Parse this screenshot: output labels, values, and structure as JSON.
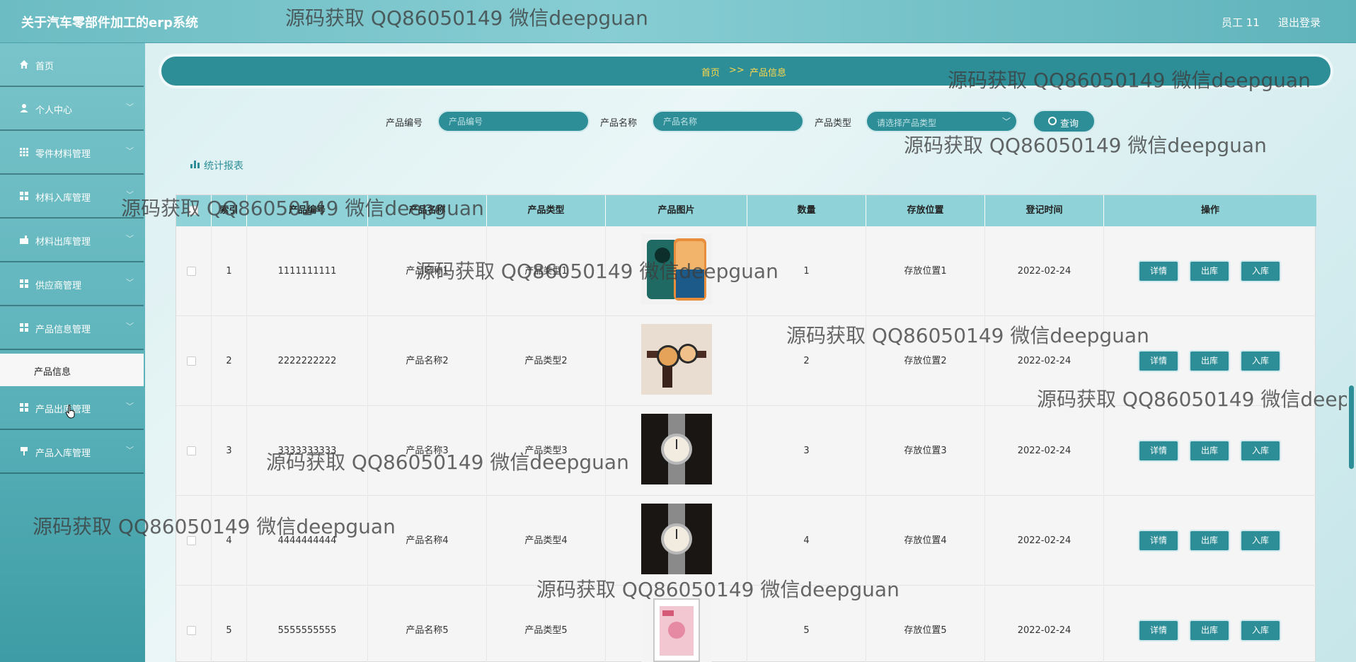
{
  "header": {
    "app_title": "关于汽车零部件加工的erp系统",
    "user_label": "员工 11",
    "logout_label": "退出登录"
  },
  "sidebar": {
    "items": [
      {
        "label": "首页",
        "icon": "home-icon"
      },
      {
        "label": "个人中心",
        "icon": "user-icon"
      },
      {
        "label": "零件材料管理",
        "icon": "grid-icon"
      },
      {
        "label": "材料入库管理",
        "icon": "grid-icon"
      },
      {
        "label": "材料出库管理",
        "icon": "building-icon"
      },
      {
        "label": "供应商管理",
        "icon": "grid-icon"
      },
      {
        "label": "产品信息管理",
        "icon": "grid-icon"
      },
      {
        "label": "产品出库管理",
        "icon": "grid-icon"
      },
      {
        "label": "产品入库管理",
        "icon": "flag-icon"
      }
    ],
    "active_submenu": "产品信息"
  },
  "breadcrumb": {
    "home": "首页",
    "separator": ">>",
    "current": "产品信息"
  },
  "search": {
    "code_label": "产品编号",
    "code_placeholder": "产品编号",
    "name_label": "产品名称",
    "name_placeholder": "产品名称",
    "type_label": "产品类型",
    "type_placeholder": "请选择产品类型",
    "button_label": "查询"
  },
  "stats_link": "统计报表",
  "table": {
    "headers": [
      "",
      "索引",
      "产品编号",
      "产品名称",
      "产品类型",
      "产品图片",
      "数量",
      "存放位置",
      "登记时间",
      "操作"
    ],
    "actions": [
      "详情",
      "出库",
      "入库"
    ],
    "rows": [
      {
        "index": "1",
        "code": "1111111111",
        "name": "产品名称1",
        "type": "产品类型1",
        "image": "phone",
        "qty": "1",
        "location": "存放位置1",
        "date": "2022-02-24"
      },
      {
        "index": "2",
        "code": "2222222222",
        "name": "产品名称2",
        "type": "产品类型2",
        "image": "watches",
        "qty": "2",
        "location": "存放位置2",
        "date": "2022-02-24"
      },
      {
        "index": "3",
        "code": "3333333333",
        "name": "产品名称3",
        "type": "产品类型3",
        "image": "watch-box",
        "qty": "3",
        "location": "存放位置3",
        "date": "2022-02-24"
      },
      {
        "index": "4",
        "code": "4444444444",
        "name": "产品名称4",
        "type": "产品类型4",
        "image": "watch-box",
        "qty": "4",
        "location": "存放位置4",
        "date": "2022-02-24"
      },
      {
        "index": "5",
        "code": "5555555555",
        "name": "产品名称5",
        "type": "产品类型5",
        "image": "pc-case",
        "qty": "5",
        "location": "存放位置5",
        "date": "2022-02-24"
      }
    ]
  },
  "watermark_text": "源码获取 QQ86050149 微信deepguan",
  "colors": {
    "primary": "#2e8e97",
    "header": "#87cdd3",
    "table_header": "#8fd3d9",
    "breadcrumb_text": "#ffd84a"
  }
}
